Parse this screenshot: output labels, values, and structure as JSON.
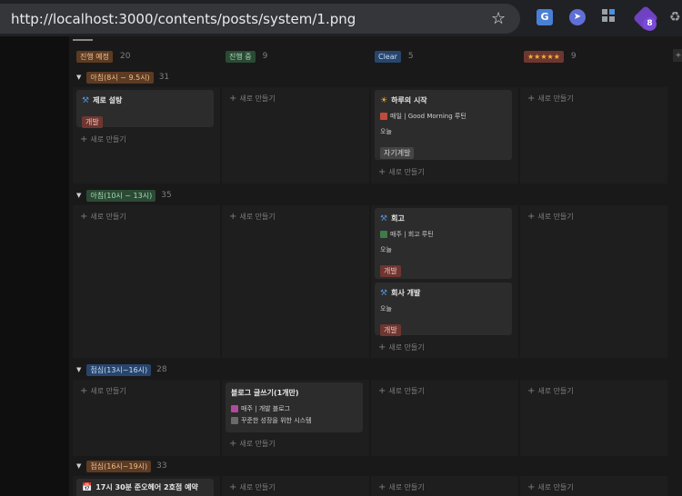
{
  "browser": {
    "url": "http://localhost:3000/contents/posts/system/1.png",
    "star_icon": "☆",
    "ext_badge": "8"
  },
  "columns": [
    {
      "label": "진행 예정",
      "count": "20",
      "color": "orange"
    },
    {
      "label": "진행 중",
      "count": "9",
      "color": "green"
    },
    {
      "label": "Clear",
      "count": "5",
      "color": "blue"
    },
    {
      "label": "★★★★★",
      "count": "9",
      "color": "red"
    }
  ],
  "new_label": "새로 만들기",
  "groups": [
    {
      "label": "아침(8시 ~ 9.5시)",
      "count": "31",
      "color": "orange"
    },
    {
      "label": "아침(10시 ~ 13시)",
      "count": "35",
      "color": "green"
    },
    {
      "label": "점심(13시~16시)",
      "count": "28",
      "color": "blue"
    },
    {
      "label": "점심(16시~19시)",
      "count": "33",
      "color": "orange"
    }
  ],
  "cards": {
    "c1": {
      "title": "제로 설탕",
      "tag": "개발"
    },
    "c2": {
      "title": "하루의 시작",
      "rel": "매일 | Good Morning 루틴",
      "date": "오늘",
      "tag": "자기계발"
    },
    "c3": {
      "title": "회고",
      "rel": "매주 | 회고 루틴",
      "date": "오늘",
      "tag": "개발"
    },
    "c4": {
      "title": "회사 개발",
      "date": "오늘",
      "tag": "개발"
    },
    "c5": {
      "title": "블로그 글쓰기(1개만)",
      "rel1": "매주 | 개발 블로그",
      "rel2": "꾸준한 성장을 위한 시스템"
    },
    "c6": {
      "title": "17시 30분 준오헤어 2호점 예약"
    }
  }
}
